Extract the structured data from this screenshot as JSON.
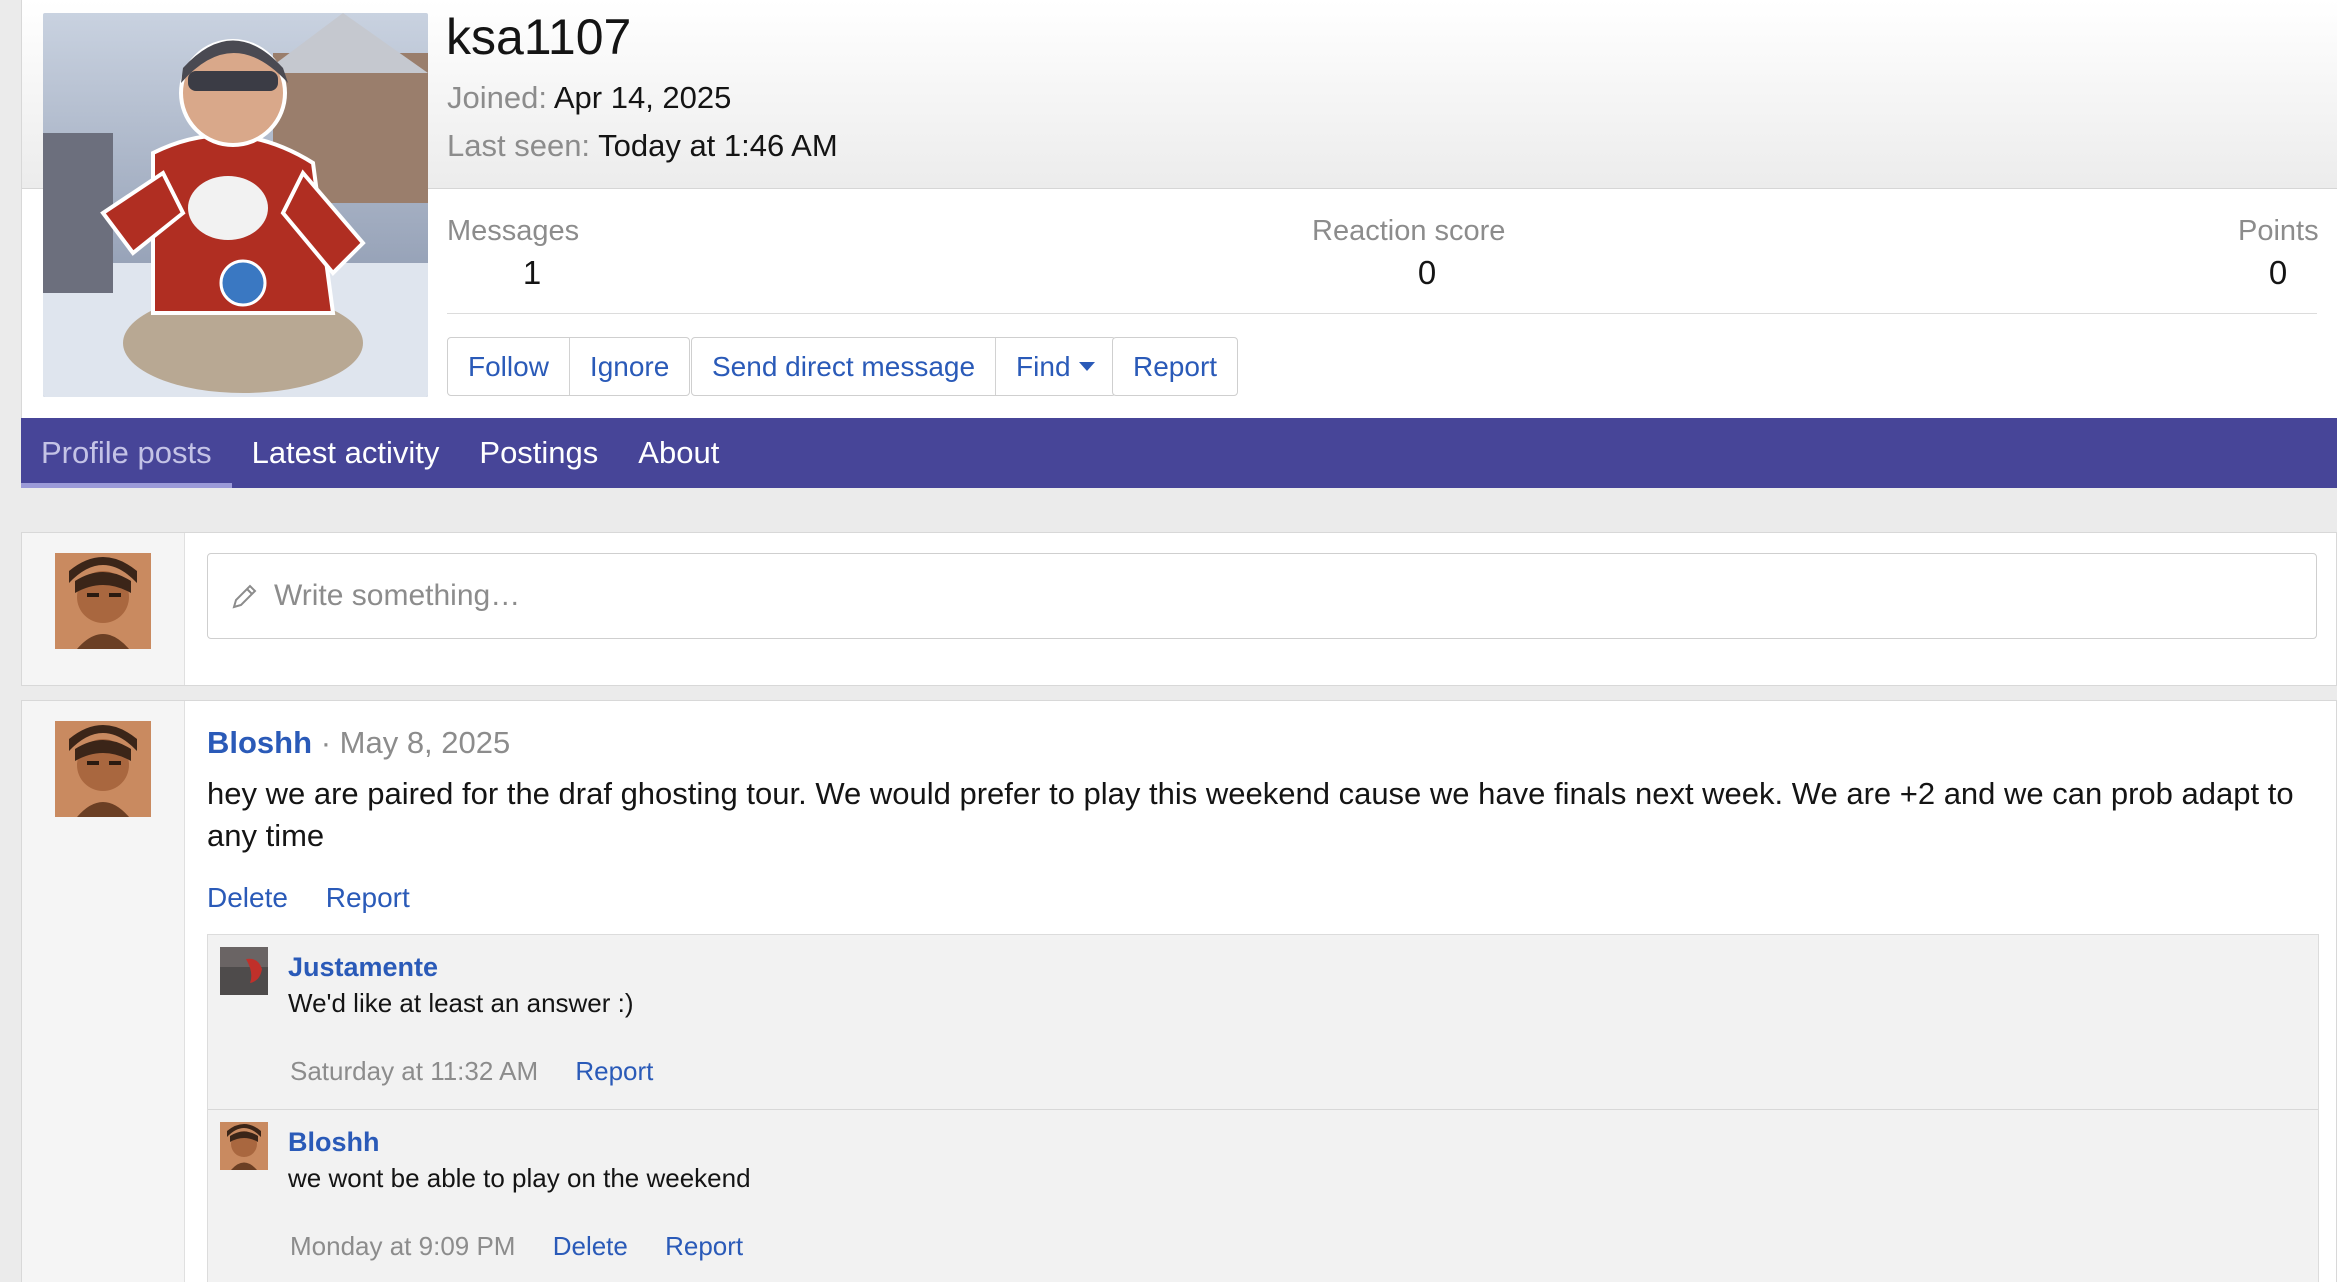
{
  "profile": {
    "username": "ksa1107",
    "joined_label": "Joined:",
    "joined_value": "Apr 14, 2025",
    "last_seen_label": "Last seen:",
    "last_seen_value": "Today at 1:46 AM"
  },
  "stats": {
    "messages_label": "Messages",
    "messages_value": "1",
    "reaction_label": "Reaction score",
    "reaction_value": "0",
    "points_label": "Points",
    "points_value": "0"
  },
  "actions": {
    "follow": "Follow",
    "ignore": "Ignore",
    "send_dm": "Send direct message",
    "find": "Find",
    "report": "Report"
  },
  "tabs": [
    {
      "label": "Profile posts",
      "active": true
    },
    {
      "label": "Latest activity",
      "active": false
    },
    {
      "label": "Postings",
      "active": false
    },
    {
      "label": "About",
      "active": false
    }
  ],
  "composer": {
    "placeholder": "Write something…",
    "icon": "pencil-icon"
  },
  "post": {
    "author": "Bloshh",
    "separator": "·",
    "date": "May 8, 2025",
    "body": "hey we are paired for the draf ghosting tour. We would prefer to play this weekend cause we have finals next week. We are +2 and we can prob adapt to any time",
    "delete_label": "Delete",
    "report_label": "Report"
  },
  "comments": [
    {
      "author": "Justamente",
      "text": "We'd like at least an answer :)",
      "time": "Saturday at 11:32 AM",
      "report_label": "Report"
    },
    {
      "author": "Bloshh",
      "text": "we wont be able to play on the weekend",
      "time": "Monday at 9:09 PM",
      "delete_label": "Delete",
      "report_label": "Report"
    }
  ],
  "colors": {
    "nav_bar": "#474598",
    "link": "#2a5ab8",
    "muted": "#8c8c8c"
  }
}
